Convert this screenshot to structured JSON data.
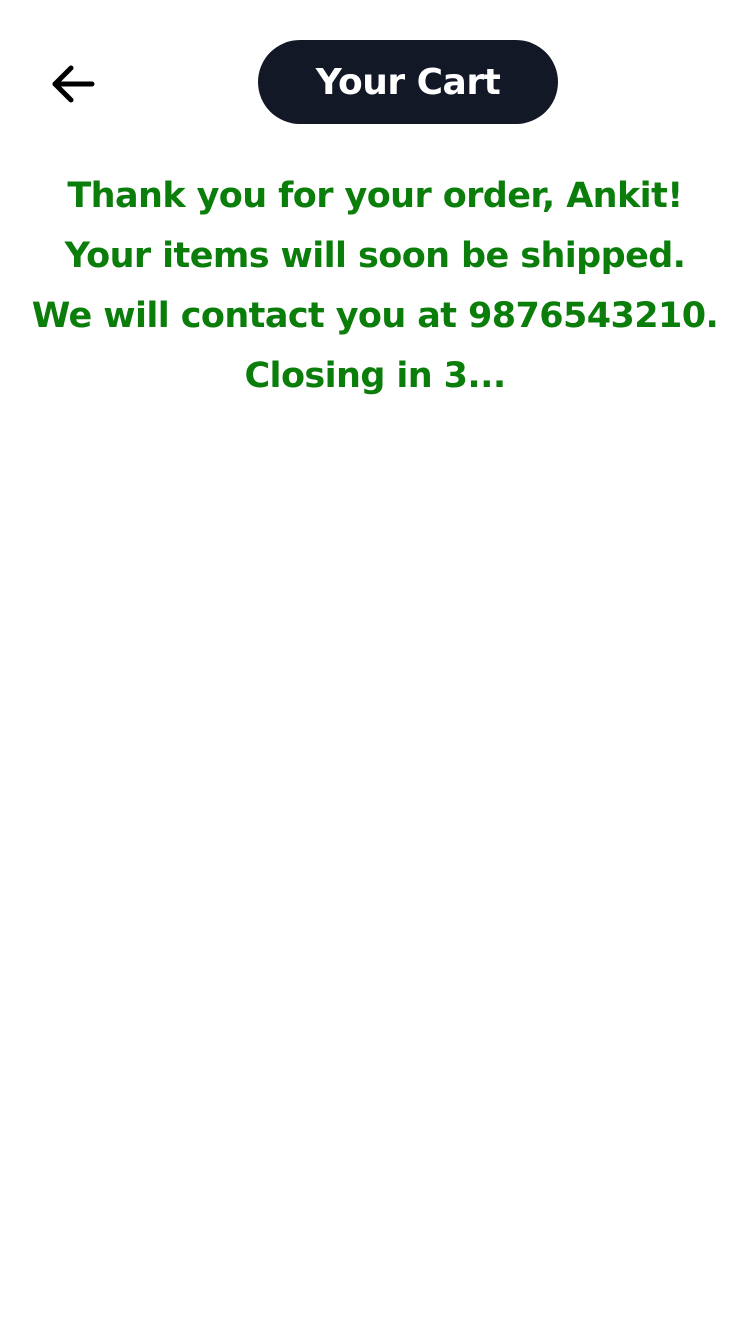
{
  "header": {
    "back_icon": "arrow-left-icon",
    "title": "Your Cart"
  },
  "confirmation": {
    "thank_you": "Thank you for your order, Ankit!",
    "shipping": "Your items will soon be shipped.",
    "contact": "We will contact you at 9876543210.",
    "closing": "Closing in 3..."
  },
  "colors": {
    "title_pill_bg": "#121826",
    "title_text": "#ffffff",
    "message_text": "#0a7d0a",
    "icon": "#000000"
  }
}
